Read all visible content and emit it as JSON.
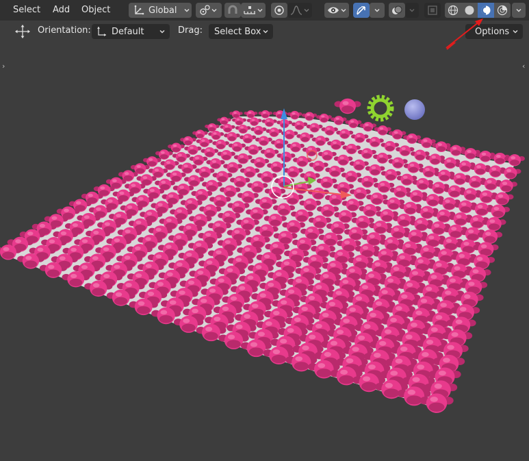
{
  "header": {
    "menu": [
      {
        "label": "Select"
      },
      {
        "label": "Add"
      },
      {
        "label": "Object"
      }
    ],
    "transform_orientation": {
      "value": "Global"
    },
    "shading_modes": [
      "wireframe",
      "solid",
      "material-preview",
      "rendered"
    ],
    "active_shading_mode": "material-preview"
  },
  "tool_settings": {
    "orientation_label": "Orientation:",
    "orientation_value": "Default",
    "drag_label": "Drag:",
    "drag_value": "Select Box",
    "options_label": "Options"
  },
  "colors": {
    "monkey": "#e83a8c",
    "monkey_shade": "#b92a6c",
    "plane": "#d8d8d8",
    "viewport_bg": "#3d3d3d",
    "header_bg": "#303030",
    "gizmo_z": "#3d8ce0",
    "gizmo_x": "#f05a5a",
    "gizmo_y": "#7ec242",
    "gear": "#8fd42f",
    "sphere": "#8d93d8",
    "annotation_arrow": "#e51c1c"
  }
}
